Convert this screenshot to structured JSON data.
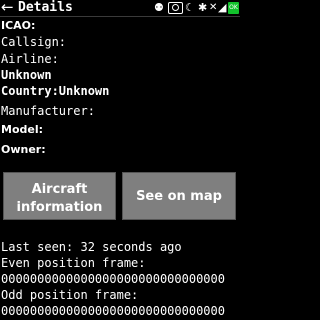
{
  "header": {
    "title": "Details",
    "battery_label": "OK"
  },
  "labels": {
    "icao": "ICAO:",
    "callsign": "Callsign:",
    "airline": "Airline:",
    "airline_value": "Unknown",
    "country": "Country:Unknown",
    "manufacturer": "Manufacturer:",
    "model": "Model:",
    "owner": "Owner:"
  },
  "buttons": {
    "aircraft_line1": "Aircraft",
    "aircraft_line2": "information",
    "map": "See on map"
  },
  "footer": {
    "last_seen": "Last seen: 32 seconds ago",
    "even_label": "Even position frame:",
    "even_value": "0000000000000000000000000000000",
    "odd_label": "Odd position frame:",
    "odd_value": "0000000000000000000000000000000"
  },
  "colors": {
    "battery": "#12c12c",
    "button": "#7f7f7f"
  }
}
